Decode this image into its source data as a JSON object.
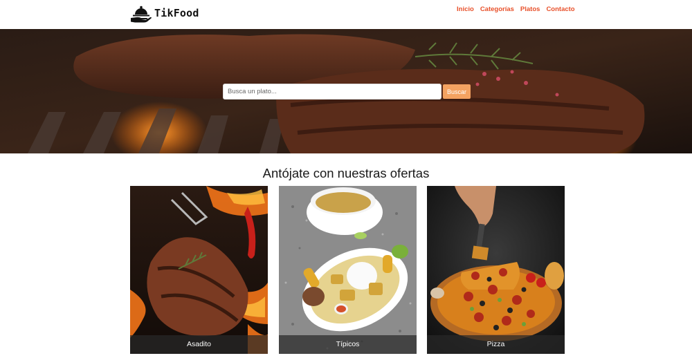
{
  "brand": {
    "name": "TikFood",
    "logo_icon": "cloche-icon"
  },
  "nav": {
    "items": [
      {
        "label": "Inicio"
      },
      {
        "label": "Categorías"
      },
      {
        "label": "Platos"
      },
      {
        "label": "Contacto"
      }
    ]
  },
  "hero": {
    "image": "grilled-steak",
    "search": {
      "placeholder": "Busca un plato...",
      "value": "",
      "button_label": "Buscar"
    }
  },
  "offers": {
    "title": "Antójate con nuestras ofertas",
    "cards": [
      {
        "label": "Asadito",
        "image": "grilled-meat-on-fire"
      },
      {
        "label": "Típicos",
        "image": "typical-dish-with-soup"
      },
      {
        "label": "Pizza",
        "image": "pizza-slice"
      }
    ]
  },
  "colors": {
    "accent": "#e8502a",
    "button": "#f4a261",
    "caption_bg": "#282828"
  }
}
